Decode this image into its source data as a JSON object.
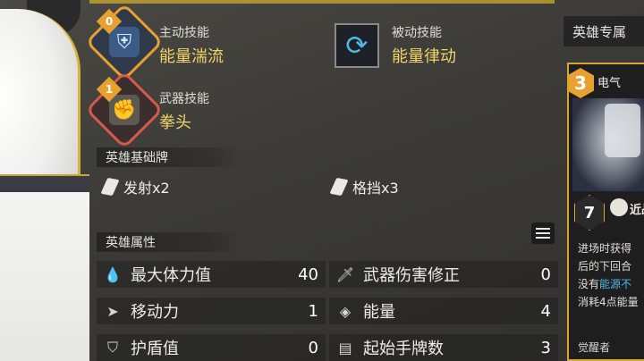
{
  "skills": {
    "active": {
      "type": "主动技能",
      "name": "能量湍流",
      "level": "0"
    },
    "passive": {
      "type": "被动技能",
      "name": "能量律动"
    },
    "weapon": {
      "type": "武器技能",
      "name": "拳头",
      "level": "1"
    }
  },
  "base_cards": {
    "title": "英雄基础牌",
    "items": [
      {
        "label": "发射x2"
      },
      {
        "label": "格挡x3"
      }
    ]
  },
  "attributes": {
    "title": "英雄属性",
    "rows": [
      {
        "label": "最大体力值",
        "value": "40"
      },
      {
        "label": "武器伤害修正",
        "value": "0"
      },
      {
        "label": "移动力",
        "value": "1"
      },
      {
        "label": "能量",
        "value": "4"
      },
      {
        "label": "护盾值",
        "value": "0"
      },
      {
        "label": "起始手牌数",
        "value": "3"
      }
    ]
  },
  "exclusive": {
    "header": "英雄专属",
    "card": {
      "cost": "3",
      "title": "电气",
      "range_value": "7",
      "range_label": "近战",
      "desc_line1": "进场时获得",
      "desc_line2": "后的下回合",
      "desc_line3_pre": "没有",
      "desc_line3_hl": "能源不",
      "desc_line4": "消耗4点能量",
      "footer": "觉醒者"
    }
  },
  "icons": {
    "active_skill": "sword-shield-icon",
    "passive_skill": "refresh-cycle-icon",
    "weapon_skill": "fist-icon",
    "list_view": "list-icon"
  },
  "colors": {
    "skill_name": "#f2d468",
    "active_border": "#e8a030",
    "weapon_border": "#d8584a",
    "energy_highlight": "#52b8e8",
    "card_border": "#d8a432"
  }
}
